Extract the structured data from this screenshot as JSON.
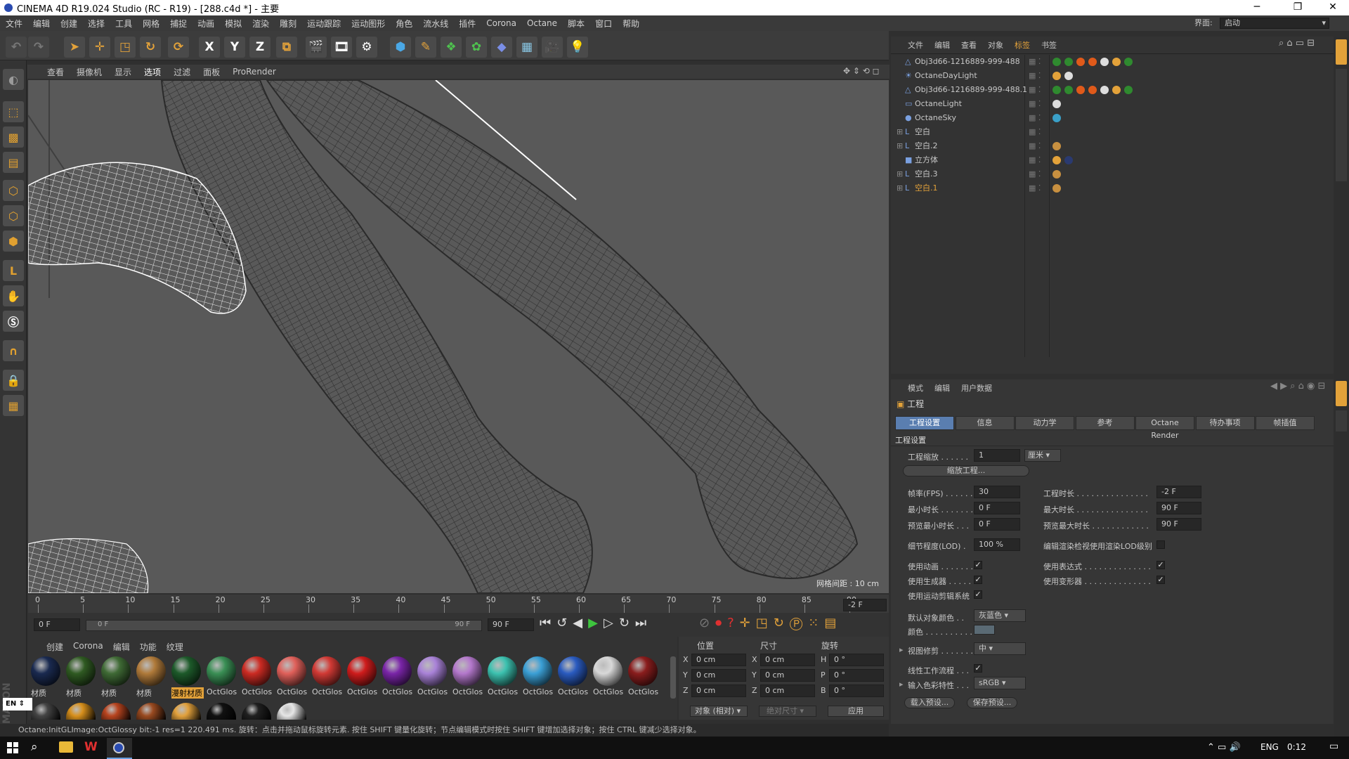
{
  "window": {
    "title": "CINEMA 4D R19.024 Studio (RC - R19) - [288.c4d *] - 主要",
    "minimize": "─",
    "maximize": "❐",
    "close": "✕"
  },
  "menu": [
    "文件",
    "编辑",
    "创建",
    "选择",
    "工具",
    "网格",
    "捕捉",
    "动画",
    "模拟",
    "渲染",
    "雕刻",
    "运动跟踪",
    "运动图形",
    "角色",
    "流水线",
    "插件",
    "Corona",
    "Octane",
    "脚本",
    "窗口",
    "帮助"
  ],
  "layout": {
    "label": "界面:",
    "value": "启动"
  },
  "toolbar": {
    "x": "X",
    "y": "Y",
    "z": "Z"
  },
  "viewport": {
    "menu": [
      "查看",
      "摄像机",
      "显示",
      "选项",
      "过滤",
      "面板",
      "ProRender"
    ],
    "grid_label": "网格间距 : 10 cm"
  },
  "timeline": {
    "ticks": [
      "0",
      "5",
      "10",
      "15",
      "20",
      "25",
      "30",
      "35",
      "40",
      "45",
      "50",
      "55",
      "60",
      "65",
      "70",
      "75",
      "80",
      "85",
      "90"
    ],
    "current": "-2 F"
  },
  "transport": {
    "start": "0 F",
    "range_start": "0 F",
    "range_end": "90 F",
    "end": "90 F"
  },
  "materials": {
    "menu": [
      "创建",
      "Corona",
      "编辑",
      "功能",
      "纹理"
    ],
    "row1": [
      {
        "label": "材质",
        "color": "#1a2a50"
      },
      {
        "label": "材质",
        "color": "#2f5a22"
      },
      {
        "label": "材质",
        "color": "#3f6a35"
      },
      {
        "label": "材质",
        "color": "#b07a3a"
      },
      {
        "label": "漫射材质",
        "color": "#1d5a2a"
      },
      {
        "label": "OctGlos",
        "color": "#3a8f55"
      },
      {
        "label": "OctGlos",
        "color": "#cc2b23"
      },
      {
        "label": "OctGlos",
        "color": "#e0605a"
      },
      {
        "label": "OctGlos",
        "color": "#d23a35"
      },
      {
        "label": "OctGlos",
        "color": "#cf1c1c"
      },
      {
        "label": "OctGlos",
        "color": "#7a25a8"
      },
      {
        "label": "OctGlos",
        "color": "#a982d8"
      },
      {
        "label": "OctGlos",
        "color": "#b478cc"
      },
      {
        "label": "OctGlos",
        "color": "#3cc2b0"
      },
      {
        "label": "OctGlos",
        "color": "#3ba0d6"
      },
      {
        "label": "OctGlos",
        "color": "#2a5bc0"
      },
      {
        "label": "OctGlos",
        "color": "#d8d8d8"
      },
      {
        "label": "OctGlos",
        "color": "#8a1d1d"
      }
    ],
    "row2": [
      "#444",
      "#d8901c",
      "#b8441f",
      "#9a4a20",
      "#e2a13c",
      "#111",
      "#202020",
      "#e6e6e6"
    ],
    "lang": "EN"
  },
  "coords": {
    "headers": [
      "位置",
      "尺寸",
      "旋转"
    ],
    "rows": [
      {
        "a": "X",
        "v1": "0 cm",
        "b": "X",
        "v2": "0 cm",
        "c": "H",
        "v3": "0 °"
      },
      {
        "a": "Y",
        "v1": "0 cm",
        "b": "Y",
        "v2": "0 cm",
        "c": "P",
        "v3": "0 °"
      },
      {
        "a": "Z",
        "v1": "0 cm",
        "b": "Z",
        "v2": "0 cm",
        "c": "B",
        "v3": "0 °"
      }
    ],
    "mode": "对象 (相对)",
    "size_mode": "绝对尺寸",
    "apply": "应用"
  },
  "status": "Octane:InitGLImage:OctGlossy  bit:-1 res=1  220.491 ms.          旋转：点击并拖动鼠标旋转元素. 按住 SHIFT 键量化旋转；节点编辑模式时按住 SHIFT 键增加选择对象；按住 CTRL 键减少选择对象。",
  "objmgr": {
    "menu": [
      "文件",
      "编辑",
      "查看",
      "对象",
      "标签",
      "书签"
    ],
    "objects": [
      {
        "name": "Obj3d66-1216889-999-488",
        "icon": "△",
        "highlight": false
      },
      {
        "name": "OctaneDayLight",
        "icon": "☀",
        "highlight": false
      },
      {
        "name": "Obj3d66-1216889-999-488.1",
        "icon": "△",
        "highlight": false
      },
      {
        "name": "OctaneLight",
        "icon": "▭",
        "highlight": false
      },
      {
        "name": "OctaneSky",
        "icon": "●",
        "highlight": false
      },
      {
        "name": "空白",
        "icon": "L",
        "highlight": false
      },
      {
        "name": "空白.2",
        "icon": "L",
        "highlight": false
      },
      {
        "name": "立方体",
        "icon": "■",
        "highlight": false
      },
      {
        "name": "空白.3",
        "icon": "L",
        "highlight": false
      },
      {
        "name": "空白.1",
        "icon": "L",
        "highlight": true
      }
    ]
  },
  "attrmgr": {
    "menu": [
      "模式",
      "编辑",
      "用户数据"
    ],
    "title": "工程",
    "tabs": [
      "工程设置",
      "信息",
      "动力学",
      "参考",
      "Octane Render",
      "待办事项",
      "帧插值"
    ],
    "section": "工程设置",
    "scale_label": "工程缩放 . . . . . .",
    "scale": "1",
    "unit": "厘米",
    "scale_btn": "缩放工程...",
    "fps_label": "帧率(FPS) . . . . . .",
    "fps": "30",
    "duration_label": "工程时长 . . . . . . . . . . . . . . .",
    "duration": "-2 F",
    "min_label": "最小时长 . . . . . . .",
    "min": "0 F",
    "max_label": "最大时长 . . . . . . . . . . . . . . .",
    "max": "90 F",
    "pmin_label": "预览最小时长 . . .",
    "pmin": "0 F",
    "pmax_label": "预览最大时长 . . . . . . . . . . . .",
    "pmax": "90 F",
    "lod_label": "细节程度(LOD) .",
    "lod": "100 %",
    "lod_render": "编辑渲染检视使用渲染LOD级别",
    "use_anim": "使用动画 . . . . . . .",
    "use_expr": "使用表达式 . . . . . . . . . . . . . .",
    "use_gen": "使用生成器 . . . . .",
    "use_deform": "使用变形器 . . . . . . . . . . . . . .",
    "use_mograph": "使用运动剪辑系统",
    "default_color_label": "默认对象颜色 . .",
    "default_color": "灰蓝色",
    "color_label": "颜色 . . . . . . . . . .",
    "clip_label": "视图修剪 . . . . . . .",
    "clip": "中",
    "linear_label": "线性工作流程 . . .",
    "input_color_label": "输入色彩特性 . . .",
    "input_color": "sRGB",
    "load_preset": "载入预设...",
    "save_preset": "保存预设..."
  },
  "taskbar": {
    "lang": "ENG",
    "time": "0:12"
  }
}
